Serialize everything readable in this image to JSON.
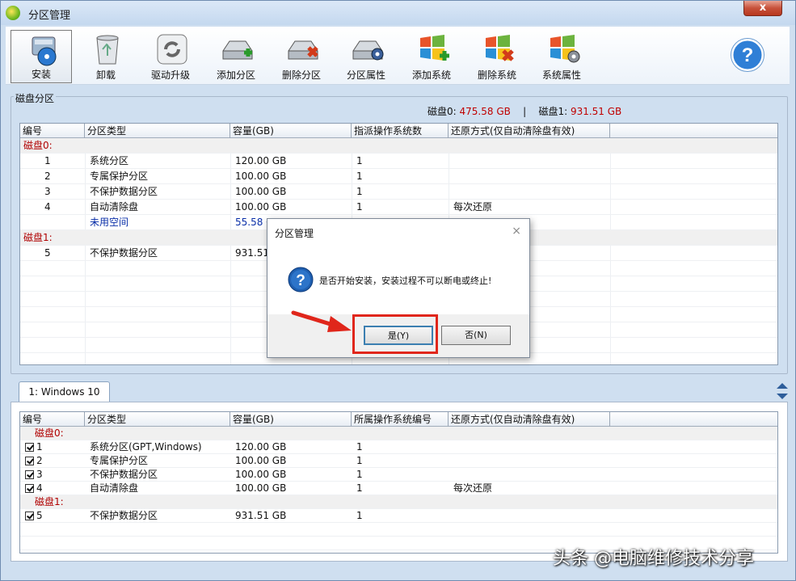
{
  "window": {
    "title": "分区管理",
    "close_label": "x"
  },
  "toolbar": {
    "items": [
      {
        "label": "安装",
        "icon": "install-icon"
      },
      {
        "label": "卸载",
        "icon": "trash-icon"
      },
      {
        "label": "驱动升级",
        "icon": "refresh-icon"
      },
      {
        "label": "添加分区",
        "icon": "disk-add-icon"
      },
      {
        "label": "删除分区",
        "icon": "disk-delete-icon"
      },
      {
        "label": "分区属性",
        "icon": "disk-gear-icon"
      },
      {
        "label": "添加系统",
        "icon": "windows-add-icon"
      },
      {
        "label": "删除系统",
        "icon": "windows-delete-icon"
      },
      {
        "label": "系统属性",
        "icon": "windows-gear-icon"
      }
    ],
    "help_icon": "help-icon"
  },
  "partitions": {
    "group_title": "磁盘分区",
    "disk0_label": "磁盘0:",
    "disk0_size": "475.58 GB",
    "separator": "|",
    "disk1_label": "磁盘1:",
    "disk1_size": "931.51 GB",
    "columns": [
      "编号",
      "分区类型",
      "容量(GB)",
      "指派操作系统数",
      "还原方式(仅自动清除盘有效)"
    ],
    "rows": [
      {
        "group": "磁盘0:"
      },
      {
        "no": "1",
        "type": "系统分区",
        "size": "120.00 GB",
        "os": "1",
        "restore": ""
      },
      {
        "no": "2",
        "type": "专属保护分区",
        "size": "100.00 GB",
        "os": "1",
        "restore": ""
      },
      {
        "no": "3",
        "type": "不保护数据分区",
        "size": "100.00 GB",
        "os": "1",
        "restore": ""
      },
      {
        "no": "4",
        "type": "自动清除盘",
        "size": "100.00 GB",
        "os": "1",
        "restore": "每次还原"
      },
      {
        "no": "",
        "type": "未用空间",
        "size": "55.58 G",
        "os": "",
        "restore": "",
        "unused": true
      },
      {
        "group": "磁盘1:"
      },
      {
        "no": "5",
        "type": "不保护数据分区",
        "size": "931.51",
        "os": "",
        "restore": ""
      }
    ]
  },
  "systems": {
    "tab_label": "1: Windows 10",
    "columns": [
      "编号",
      "分区类型",
      "容量(GB)",
      "所属操作系统编号",
      "还原方式(仅自动清除盘有效)"
    ],
    "rows": [
      {
        "group": "磁盘0:"
      },
      {
        "no": "1",
        "type": "系统分区(GPT,Windows)",
        "size": "120.00 GB",
        "os": "1",
        "restore": "",
        "checked": true
      },
      {
        "no": "2",
        "type": "专属保护分区",
        "size": "100.00 GB",
        "os": "1",
        "restore": "",
        "checked": true
      },
      {
        "no": "3",
        "type": "不保护数据分区",
        "size": "100.00 GB",
        "os": "1",
        "restore": "",
        "checked": true
      },
      {
        "no": "4",
        "type": "自动清除盘",
        "size": "100.00 GB",
        "os": "1",
        "restore": "每次还原",
        "checked": true
      },
      {
        "group": "磁盘1:"
      },
      {
        "no": "5",
        "type": "不保护数据分区",
        "size": "931.51 GB",
        "os": "1",
        "restore": "",
        "checked": true
      }
    ]
  },
  "dialog": {
    "title": "分区管理",
    "close_label": "×",
    "message": "是否开始安装，安装过程不可以断电或终止!",
    "yes_label": "是(Y)",
    "no_label": "否(N)"
  },
  "watermark": "头条 @电脑维修技术分享",
  "colors": {
    "disk_red": "#c00000",
    "unused_blue": "#0a2fa8",
    "highlight": "#e0261b"
  }
}
